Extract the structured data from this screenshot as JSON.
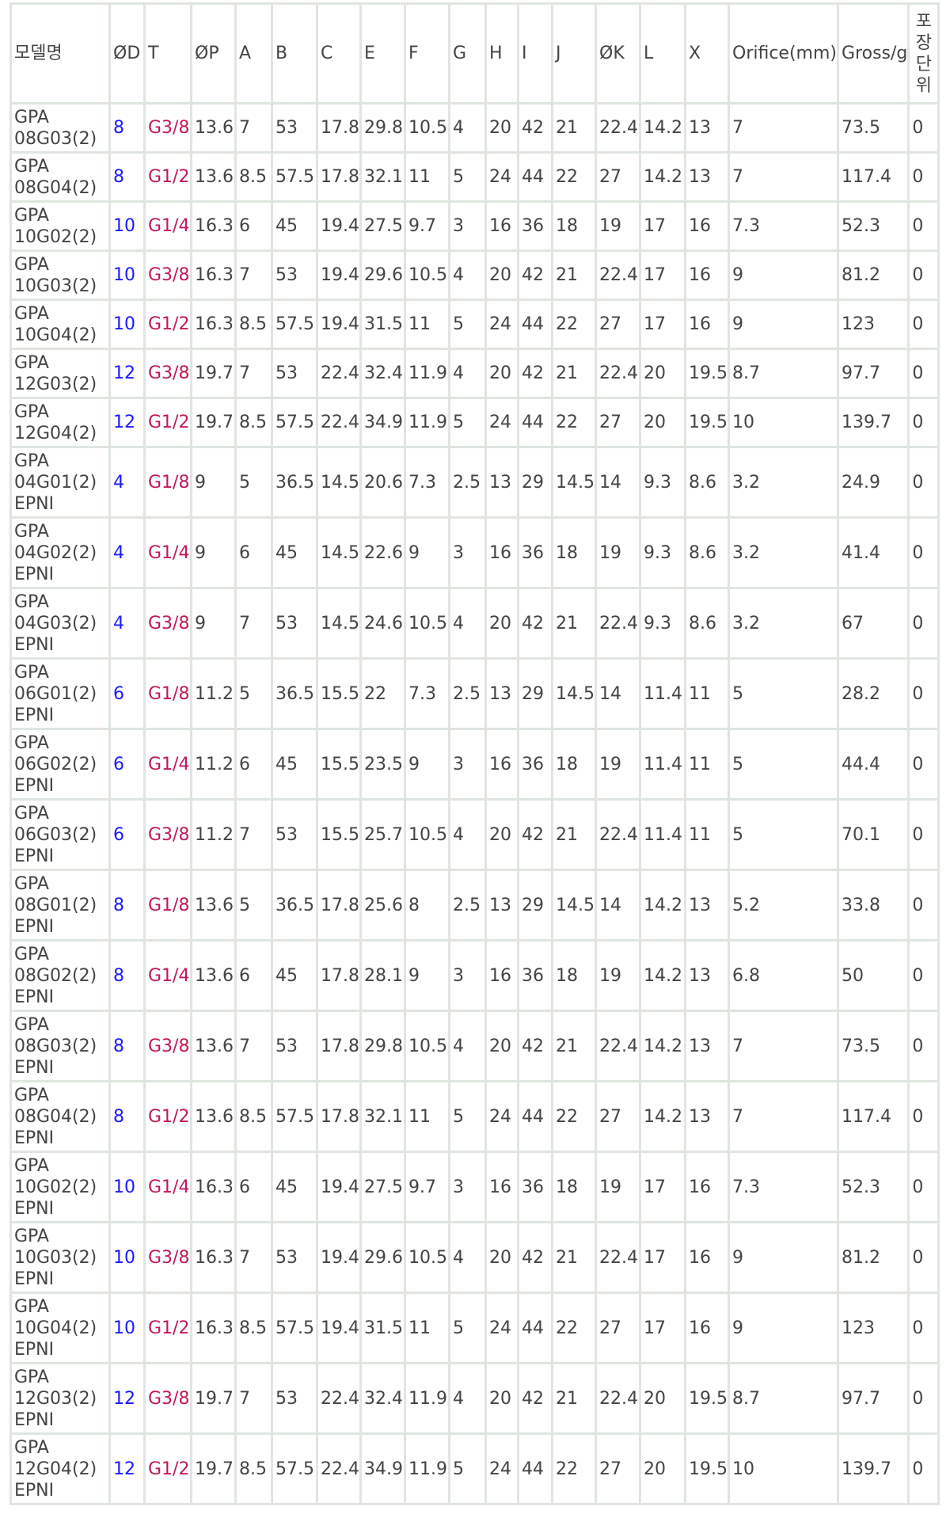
{
  "colors": {
    "diameter": "#1a1aff",
    "thread": "#c2185b",
    "border": "#dfe6df",
    "text": "#444444"
  },
  "headers": [
    "모델명",
    "ØD",
    "T",
    "ØP",
    "A",
    "B",
    "C",
    "E",
    "F",
    "G",
    "H",
    "I",
    "J",
    "ØK",
    "L",
    "X",
    "Orifice(mm)",
    "Gross/g"
  ],
  "last_header_chars": [
    "포",
    "장",
    "단",
    "위"
  ],
  "rows": [
    {
      "model": [
        "GPA",
        "08G03(2)"
      ],
      "v": [
        "8",
        "G3/8",
        "13.6",
        "7",
        "53",
        "17.8",
        "29.8",
        "10.5",
        "4",
        "20",
        "42",
        "21",
        "22.4",
        "14.2",
        "13",
        "7",
        "73.5",
        "0"
      ]
    },
    {
      "model": [
        "GPA",
        "08G04(2)"
      ],
      "v": [
        "8",
        "G1/2",
        "13.6",
        "8.5",
        "57.5",
        "17.8",
        "32.1",
        "11",
        "5",
        "24",
        "44",
        "22",
        "27",
        "14.2",
        "13",
        "7",
        "117.4",
        "0"
      ]
    },
    {
      "model": [
        "GPA",
        "10G02(2)"
      ],
      "v": [
        "10",
        "G1/4",
        "16.3",
        "6",
        "45",
        "19.4",
        "27.5",
        "9.7",
        "3",
        "16",
        "36",
        "18",
        "19",
        "17",
        "16",
        "7.3",
        "52.3",
        "0"
      ]
    },
    {
      "model": [
        "GPA",
        "10G03(2)"
      ],
      "v": [
        "10",
        "G3/8",
        "16.3",
        "7",
        "53",
        "19.4",
        "29.6",
        "10.5",
        "4",
        "20",
        "42",
        "21",
        "22.4",
        "17",
        "16",
        "9",
        "81.2",
        "0"
      ]
    },
    {
      "model": [
        "GPA",
        "10G04(2)"
      ],
      "v": [
        "10",
        "G1/2",
        "16.3",
        "8.5",
        "57.5",
        "19.4",
        "31.5",
        "11",
        "5",
        "24",
        "44",
        "22",
        "27",
        "17",
        "16",
        "9",
        "123",
        "0"
      ]
    },
    {
      "model": [
        "GPA",
        "12G03(2)"
      ],
      "v": [
        "12",
        "G3/8",
        "19.7",
        "7",
        "53",
        "22.4",
        "32.4",
        "11.9",
        "4",
        "20",
        "42",
        "21",
        "22.4",
        "20",
        "19.5",
        "8.7",
        "97.7",
        "0"
      ]
    },
    {
      "model": [
        "GPA",
        "12G04(2)"
      ],
      "v": [
        "12",
        "G1/2",
        "19.7",
        "8.5",
        "57.5",
        "22.4",
        "34.9",
        "11.9",
        "5",
        "24",
        "44",
        "22",
        "27",
        "20",
        "19.5",
        "10",
        "139.7",
        "0"
      ]
    },
    {
      "model": [
        "GPA",
        "04G01(2)",
        "EPNI"
      ],
      "v": [
        "4",
        "G1/8",
        "9",
        "5",
        "36.5",
        "14.5",
        "20.6",
        "7.3",
        "2.5",
        "13",
        "29",
        "14.5",
        "14",
        "9.3",
        "8.6",
        "3.2",
        "24.9",
        "0"
      ]
    },
    {
      "model": [
        "GPA",
        "04G02(2)",
        "EPNI"
      ],
      "v": [
        "4",
        "G1/4",
        "9",
        "6",
        "45",
        "14.5",
        "22.6",
        "9",
        "3",
        "16",
        "36",
        "18",
        "19",
        "9.3",
        "8.6",
        "3.2",
        "41.4",
        "0"
      ]
    },
    {
      "model": [
        "GPA",
        "04G03(2)",
        "EPNI"
      ],
      "v": [
        "4",
        "G3/8",
        "9",
        "7",
        "53",
        "14.5",
        "24.6",
        "10.5",
        "4",
        "20",
        "42",
        "21",
        "22.4",
        "9.3",
        "8.6",
        "3.2",
        "67",
        "0"
      ]
    },
    {
      "model": [
        "GPA",
        "06G01(2)",
        "EPNI"
      ],
      "v": [
        "6",
        "G1/8",
        "11.2",
        "5",
        "36.5",
        "15.5",
        "22",
        "7.3",
        "2.5",
        "13",
        "29",
        "14.5",
        "14",
        "11.4",
        "11",
        "5",
        "28.2",
        "0"
      ]
    },
    {
      "model": [
        "GPA",
        "06G02(2)",
        "EPNI"
      ],
      "v": [
        "6",
        "G1/4",
        "11.2",
        "6",
        "45",
        "15.5",
        "23.5",
        "9",
        "3",
        "16",
        "36",
        "18",
        "19",
        "11.4",
        "11",
        "5",
        "44.4",
        "0"
      ]
    },
    {
      "model": [
        "GPA",
        "06G03(2)",
        "EPNI"
      ],
      "v": [
        "6",
        "G3/8",
        "11.2",
        "7",
        "53",
        "15.5",
        "25.7",
        "10.5",
        "4",
        "20",
        "42",
        "21",
        "22.4",
        "11.4",
        "11",
        "5",
        "70.1",
        "0"
      ]
    },
    {
      "model": [
        "GPA",
        "08G01(2)",
        "EPNI"
      ],
      "v": [
        "8",
        "G1/8",
        "13.6",
        "5",
        "36.5",
        "17.8",
        "25.6",
        "8",
        "2.5",
        "13",
        "29",
        "14.5",
        "14",
        "14.2",
        "13",
        "5.2",
        "33.8",
        "0"
      ]
    },
    {
      "model": [
        "GPA",
        "08G02(2)",
        "EPNI"
      ],
      "v": [
        "8",
        "G1/4",
        "13.6",
        "6",
        "45",
        "17.8",
        "28.1",
        "9",
        "3",
        "16",
        "36",
        "18",
        "19",
        "14.2",
        "13",
        "6.8",
        "50",
        "0"
      ]
    },
    {
      "model": [
        "GPA",
        "08G03(2)",
        "EPNI"
      ],
      "v": [
        "8",
        "G3/8",
        "13.6",
        "7",
        "53",
        "17.8",
        "29.8",
        "10.5",
        "4",
        "20",
        "42",
        "21",
        "22.4",
        "14.2",
        "13",
        "7",
        "73.5",
        "0"
      ]
    },
    {
      "model": [
        "GPA",
        "08G04(2)",
        "EPNI"
      ],
      "v": [
        "8",
        "G1/2",
        "13.6",
        "8.5",
        "57.5",
        "17.8",
        "32.1",
        "11",
        "5",
        "24",
        "44",
        "22",
        "27",
        "14.2",
        "13",
        "7",
        "117.4",
        "0"
      ]
    },
    {
      "model": [
        "GPA",
        "10G02(2)",
        "EPNI"
      ],
      "v": [
        "10",
        "G1/4",
        "16.3",
        "6",
        "45",
        "19.4",
        "27.5",
        "9.7",
        "3",
        "16",
        "36",
        "18",
        "19",
        "17",
        "16",
        "7.3",
        "52.3",
        "0"
      ]
    },
    {
      "model": [
        "GPA",
        "10G03(2)",
        "EPNI"
      ],
      "v": [
        "10",
        "G3/8",
        "16.3",
        "7",
        "53",
        "19.4",
        "29.6",
        "10.5",
        "4",
        "20",
        "42",
        "21",
        "22.4",
        "17",
        "16",
        "9",
        "81.2",
        "0"
      ]
    },
    {
      "model": [
        "GPA",
        "10G04(2)",
        "EPNI"
      ],
      "v": [
        "10",
        "G1/2",
        "16.3",
        "8.5",
        "57.5",
        "19.4",
        "31.5",
        "11",
        "5",
        "24",
        "44",
        "22",
        "27",
        "17",
        "16",
        "9",
        "123",
        "0"
      ]
    },
    {
      "model": [
        "GPA",
        "12G03(2)",
        "EPNI"
      ],
      "v": [
        "12",
        "G3/8",
        "19.7",
        "7",
        "53",
        "22.4",
        "32.4",
        "11.9",
        "4",
        "20",
        "42",
        "21",
        "22.4",
        "20",
        "19.5",
        "8.7",
        "97.7",
        "0"
      ]
    },
    {
      "model": [
        "GPA",
        "12G04(2)",
        "EPNI"
      ],
      "v": [
        "12",
        "G1/2",
        "19.7",
        "8.5",
        "57.5",
        "22.4",
        "34.9",
        "11.9",
        "5",
        "24",
        "44",
        "22",
        "27",
        "20",
        "19.5",
        "10",
        "139.7",
        "0"
      ]
    }
  ]
}
